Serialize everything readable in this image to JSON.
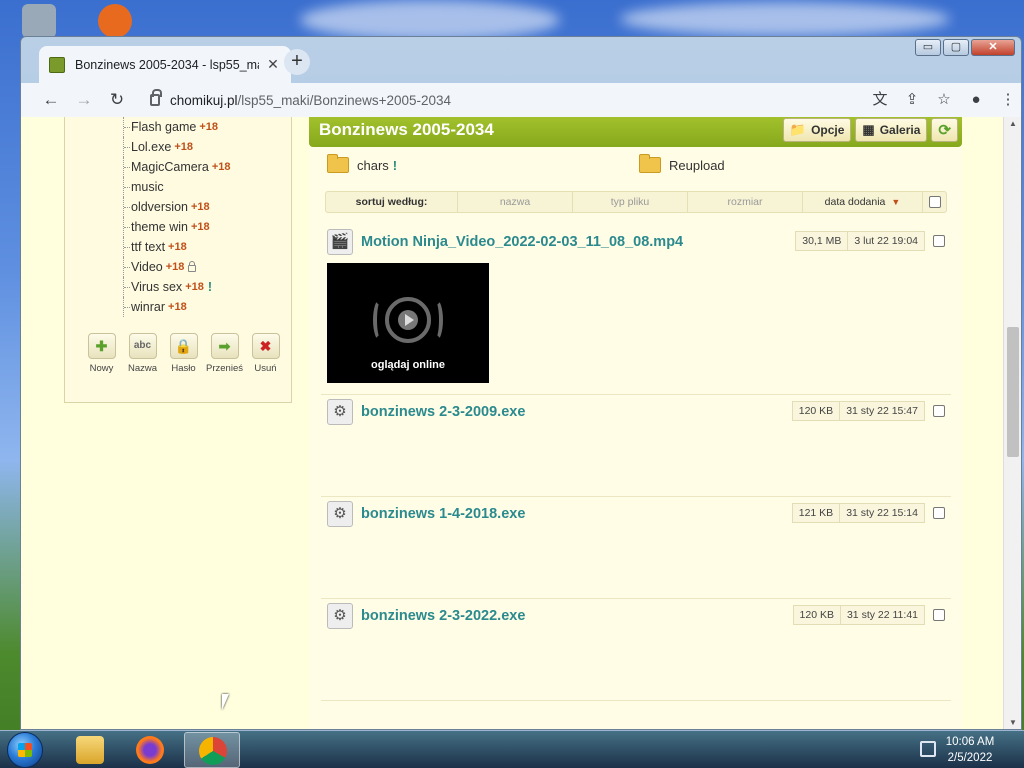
{
  "browser": {
    "tab_title": "Bonzinews 2005-2034 - lsp55_maki",
    "tab_close": "✕",
    "new_tab": "+",
    "url_host": "chomikuj.pl",
    "url_path": "/lsp55_maki/Bonzinews+2005-2034",
    "back": "←",
    "forward": "→",
    "reload": "↻"
  },
  "window_controls": {
    "minimize": "▭",
    "maximize": "▢",
    "close": "✕"
  },
  "tree": {
    "badge": "+18",
    "items": [
      {
        "label": "Flash game",
        "badge": true
      },
      {
        "label": "Lol.exe",
        "badge": true
      },
      {
        "label": "MagicCamera",
        "badge": true
      },
      {
        "label": "music",
        "badge": false
      },
      {
        "label": "oldversion",
        "badge": true
      },
      {
        "label": "theme win",
        "badge": true
      },
      {
        "label": "ttf text",
        "badge": true
      },
      {
        "label": "Video",
        "badge": true,
        "locked": true
      },
      {
        "label": "Virus sex",
        "badge": true,
        "alert": "!"
      },
      {
        "label": "winrar",
        "badge": true
      }
    ]
  },
  "folder_actions": [
    {
      "label": "Nowy",
      "glyph": "✚",
      "color": "#5aa02c"
    },
    {
      "label": "Nazwa",
      "glyph": "abc",
      "color": "#666666"
    },
    {
      "label": "Hasło",
      "glyph": "🔒",
      "color": "#8a7a30"
    },
    {
      "label": "Przenieś",
      "glyph": "➡",
      "color": "#5aa02c"
    },
    {
      "label": "Usuń",
      "glyph": "✖",
      "color": "#cc2222"
    }
  ],
  "main": {
    "title": "Bonzinews 2005-2034",
    "buttons": {
      "options": "Opcje",
      "gallery": "Galeria"
    },
    "subfolders": [
      {
        "name": "chars",
        "alert": "!"
      },
      {
        "name": "Reupload"
      }
    ],
    "sort": {
      "label": "sortuj według:",
      "name": "nazwa",
      "type": "typ pliku",
      "size": "rozmiar",
      "date": "data dodania",
      "arrow": "▼"
    },
    "files": [
      {
        "name": "Motion Ninja_Video_2022-02-03_11_08_08.mp4",
        "size": "30,1 MB",
        "date": "3 lut 22 19:04",
        "type": "video"
      },
      {
        "name": "bonzinews 2-3-2009.exe",
        "size": "120 KB",
        "date": "31 sty 22 15:47",
        "type": "exe"
      },
      {
        "name": "bonzinews 1-4-2018.exe",
        "size": "121 KB",
        "date": "31 sty 22 15:14",
        "type": "exe"
      },
      {
        "name": "bonzinews 2-3-2022.exe",
        "size": "120 KB",
        "date": "31 sty 22 11:41",
        "type": "exe"
      }
    ],
    "watch_online": "oglądaj online"
  },
  "taskbar": {
    "time": "10:06 AM",
    "date": "2/5/2022"
  },
  "colors": {
    "header_green": "#95b524",
    "file_link": "#2b8a8e",
    "badge": "#c0501a",
    "page_bg": "#ffffdd"
  }
}
